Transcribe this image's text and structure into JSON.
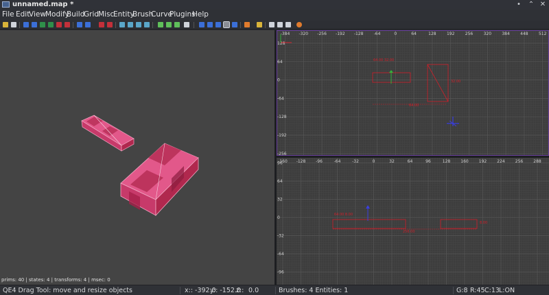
{
  "window": {
    "title": "unnamed.map *",
    "min_glyph": "•",
    "restore_glyph": "⌃",
    "close_glyph": "✕"
  },
  "menu": {
    "file": "File",
    "edit": "Edit",
    "view": "View",
    "modify": "Modify",
    "build": "Build",
    "grid": "Grid",
    "misc": "Misc",
    "entity": "Entity",
    "brush": "Brush",
    "curve": "Curve",
    "plugins": "Plugins",
    "help": "Help"
  },
  "view3d": {
    "stats": "prims: 40 | states: 4 | transforms: 4 | msec: 0"
  },
  "top_view": {
    "x_ticks": [
      "-384",
      "-320",
      "-256",
      "-192",
      "-128",
      "-64",
      "0",
      "64",
      "128",
      "192",
      "256",
      "320",
      "384",
      "448",
      "512"
    ],
    "y_ticks": [
      "128",
      "64",
      "0",
      "-64",
      "-128",
      "-192",
      "-256"
    ],
    "dim_a": "64.00  32.00",
    "dim_b": "32.00",
    "dim_c": "64.00"
  },
  "front_view": {
    "x_ticks": [
      "-160",
      "-128",
      "-96",
      "-64",
      "-32",
      "0",
      "32",
      "64",
      "96",
      "128",
      "160",
      "192",
      "224",
      "256",
      "288"
    ],
    "y_ticks": [
      "96",
      "64",
      "32",
      "0",
      "-32",
      "-64",
      "-96"
    ],
    "dim_a": "64.00  8.00",
    "dim_b": "8.00",
    "dim_c": "256.00"
  },
  "status": {
    "tool": "QE4 Drag Tool: move and resize objects",
    "x": "x:: -392.0",
    "y": "y:: -152.0",
    "z": "z::",
    "zval": "0.0",
    "counts": "Brushes: 4 Entities: 1",
    "grid": "G:8",
    "rot": "R:45",
    "clip": "C:13",
    "lock": "L:ON"
  },
  "colors": {
    "brush_fill": "#e2588a",
    "brush_dark": "#b0284e",
    "selection": "#d11f2a",
    "grid_major": "#575757",
    "grid_minor": "#474747"
  }
}
